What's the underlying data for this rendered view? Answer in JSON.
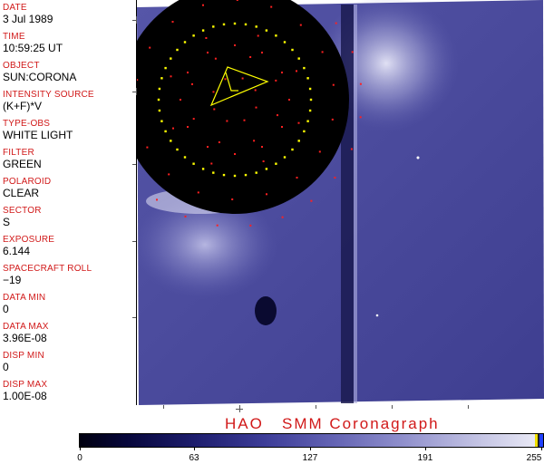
{
  "header": {
    "fields": [
      {
        "label": "DATE",
        "value": "3 Jul 1989"
      },
      {
        "label": "TIME",
        "value": "10:59:25 UT"
      },
      {
        "label": "OBJECT",
        "value": "SUN:CORONA"
      },
      {
        "label": "INTENSITY SOURCE",
        "value": "(K+F)*V"
      },
      {
        "label": "TYPE-OBS",
        "value": "WHITE LIGHT"
      },
      {
        "label": "FILTER",
        "value": "GREEN"
      },
      {
        "label": "POLAROID",
        "value": "CLEAR"
      },
      {
        "label": "SECTOR",
        "value": "S"
      },
      {
        "label": "EXPOSURE",
        "value": "6.144"
      },
      {
        "label": "SPACECRAFT ROLL",
        "value": "−19"
      },
      {
        "label": "DATA MIN",
        "value": "0"
      },
      {
        "label": "DATA MAX",
        "value": "3.96E-08"
      },
      {
        "label": "DISP MIN",
        "value": "0"
      },
      {
        "label": "DISP MAX",
        "value": "1.00E-08"
      }
    ]
  },
  "footer": {
    "title": "HAO   SMM Coronagraph",
    "colorbar_ticks": [
      "0",
      "63",
      "127",
      "191",
      "255"
    ]
  },
  "colors": {
    "label_red": "#d11919",
    "image_blue": "#4a4a9e",
    "occulter": "#000000",
    "marker_yellow": "#ffff00",
    "marker_red": "#ff2020"
  }
}
